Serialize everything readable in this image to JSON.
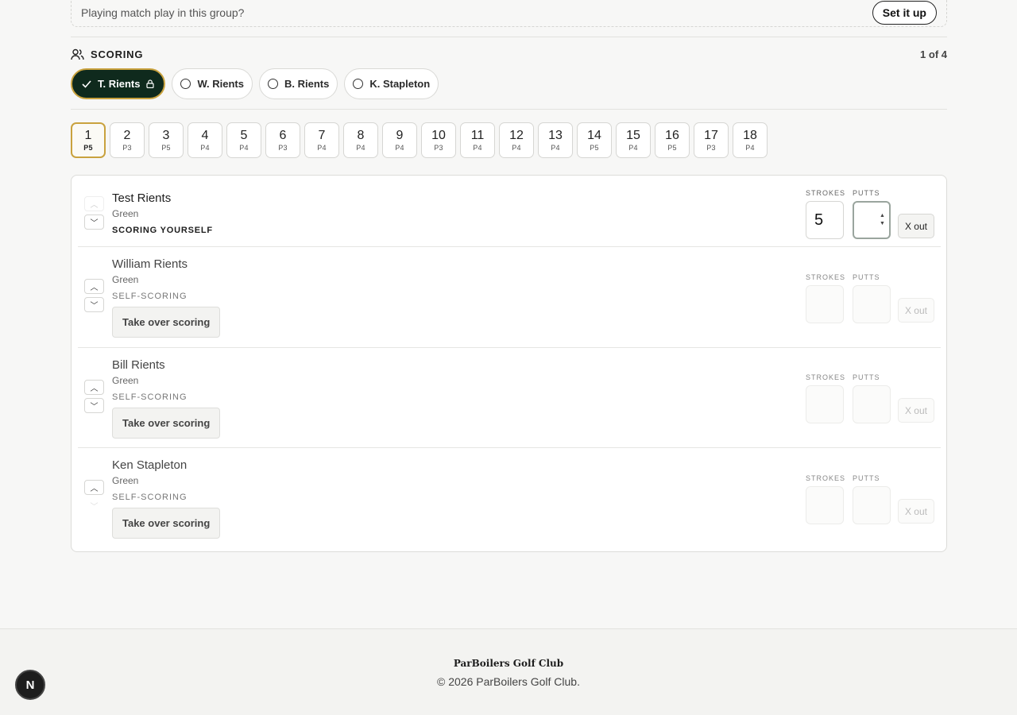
{
  "banner": {
    "text": "Playing match play in this group?",
    "button": "Set it up"
  },
  "scoring": {
    "title": "SCORING",
    "count": "1 of 4"
  },
  "chips": [
    {
      "label": "T. Rients",
      "active": true
    },
    {
      "label": "W. Rients",
      "active": false
    },
    {
      "label": "B. Rients",
      "active": false
    },
    {
      "label": "K. Stapleton",
      "active": false
    }
  ],
  "holes": [
    {
      "num": "1",
      "par": "P5"
    },
    {
      "num": "2",
      "par": "P3"
    },
    {
      "num": "3",
      "par": "P5"
    },
    {
      "num": "4",
      "par": "P4"
    },
    {
      "num": "5",
      "par": "P4"
    },
    {
      "num": "6",
      "par": "P3"
    },
    {
      "num": "7",
      "par": "P4"
    },
    {
      "num": "8",
      "par": "P4"
    },
    {
      "num": "9",
      "par": "P4"
    },
    {
      "num": "10",
      "par": "P3"
    },
    {
      "num": "11",
      "par": "P4"
    },
    {
      "num": "12",
      "par": "P4"
    },
    {
      "num": "13",
      "par": "P4"
    },
    {
      "num": "14",
      "par": "P5"
    },
    {
      "num": "15",
      "par": "P4"
    },
    {
      "num": "16",
      "par": "P5"
    },
    {
      "num": "17",
      "par": "P3"
    },
    {
      "num": "18",
      "par": "P4"
    }
  ],
  "players": [
    {
      "name": "Test Rients",
      "tee": "Green",
      "status": "SCORING YOURSELF",
      "strokes": "5",
      "putts": "",
      "takeover": ""
    },
    {
      "name": "William Rients",
      "tee": "Green",
      "status": "SELF-SCORING",
      "strokes": "",
      "putts": "",
      "takeover": "Take over scoring"
    },
    {
      "name": "Bill Rients",
      "tee": "Green",
      "status": "SELF-SCORING",
      "strokes": "",
      "putts": "",
      "takeover": "Take over scoring"
    },
    {
      "name": "Ken Stapleton",
      "tee": "Green",
      "status": "SELF-SCORING",
      "strokes": "",
      "putts": "",
      "takeover": "Take over scoring"
    }
  ],
  "labels": {
    "strokes": "STROKES",
    "putts": "PUTTS",
    "xout": "X out"
  },
  "footer": {
    "club": "ParBoilers Golf Club",
    "copyright": "© 2026 ParBoilers Golf Club."
  },
  "badge": "N"
}
